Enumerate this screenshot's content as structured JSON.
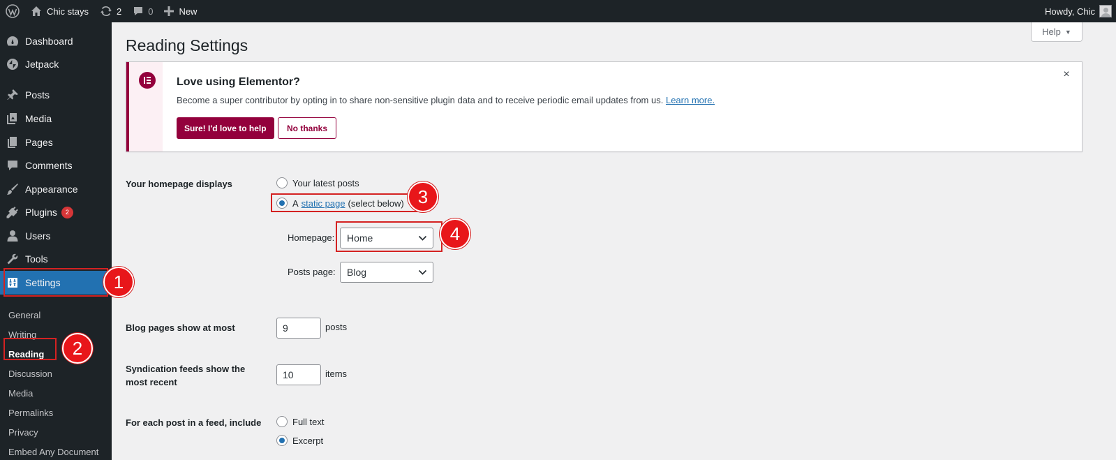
{
  "adminbar": {
    "site_name": "Chic stays",
    "updates_count": "2",
    "comments_count": "0",
    "new_label": "New",
    "howdy": "Howdy, Chic"
  },
  "sidebar": {
    "items": [
      {
        "label": "Dashboard",
        "icon": "dashboard-icon"
      },
      {
        "label": "Jetpack",
        "icon": "jetpack-icon"
      },
      {
        "label": "Posts",
        "icon": "pin-icon"
      },
      {
        "label": "Media",
        "icon": "media-icon"
      },
      {
        "label": "Pages",
        "icon": "pages-icon"
      },
      {
        "label": "Comments",
        "icon": "comment-icon"
      },
      {
        "label": "Appearance",
        "icon": "brush-icon"
      },
      {
        "label": "Plugins",
        "icon": "plugin-icon",
        "badge": "2"
      },
      {
        "label": "Users",
        "icon": "user-icon"
      },
      {
        "label": "Tools",
        "icon": "wrench-icon"
      },
      {
        "label": "Settings",
        "icon": "settings-icon",
        "active": true
      }
    ],
    "submenu": [
      "General",
      "Writing",
      "Reading",
      "Discussion",
      "Media",
      "Permalinks",
      "Privacy",
      "Embed Any Document"
    ]
  },
  "annotations": [
    "1",
    "2",
    "3",
    "4"
  ],
  "page": {
    "title": "Reading Settings",
    "help_label": "Help"
  },
  "notice": {
    "title": "Love using Elementor?",
    "text": "Become a super contributor by opting in to share non-sensitive plugin data and to receive periodic email updates from us.",
    "link": "Learn more.",
    "primary_button": "Sure! I'd love to help",
    "secondary_button": "No thanks",
    "close": "×"
  },
  "settings": {
    "homepage_displays": {
      "label": "Your homepage displays",
      "option_latest": "Your latest posts",
      "option_static_prefix": "A",
      "option_static_link": "static page",
      "option_static_suffix": "(select below)",
      "selected": "static page"
    },
    "homepage": {
      "label": "Homepage:",
      "value": "Home"
    },
    "posts_page": {
      "label": "Posts page:",
      "value": "Blog"
    },
    "blog_pages": {
      "label": "Blog pages show at most",
      "value": "9",
      "suffix": "posts"
    },
    "syndication": {
      "label_line1": "Syndication feeds show the",
      "label_line2": "most recent",
      "value": "10",
      "suffix": "items"
    },
    "feed_include": {
      "label": "For each post in a feed, include",
      "option_full": "Full text",
      "option_excerpt": "Excerpt",
      "selected": "Excerpt"
    }
  },
  "colors": {
    "adminbar_bg": "#1d2327",
    "accent": "#2271b1",
    "elementor": "#93003c",
    "annotation": "#e8161a"
  }
}
